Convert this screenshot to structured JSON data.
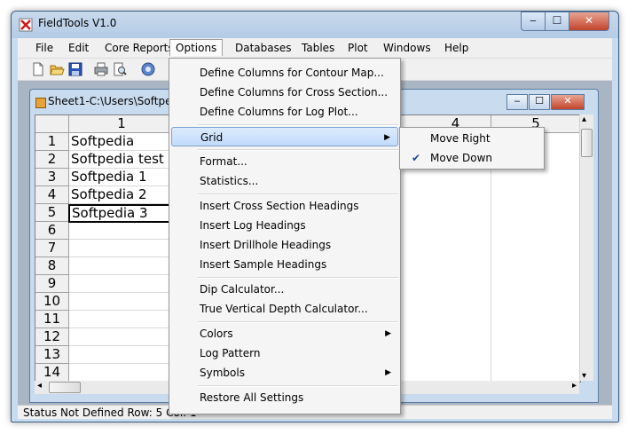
{
  "window": {
    "title": "FieldTools V1.0",
    "min": "‒",
    "max": "☐",
    "close": "✕"
  },
  "menubar": [
    "File",
    "Edit",
    "Core Reports",
    "Options",
    "Databases",
    "Tables",
    "Plot",
    "Windows",
    "Help"
  ],
  "toolbar": [
    "new-icon",
    "open-icon",
    "save-icon",
    "print-icon",
    "print-preview-icon",
    "settings-icon"
  ],
  "child": {
    "title": "Sheet1-C:\\Users\\Softpedia",
    "min": "‒",
    "max": "☐",
    "close": "✕"
  },
  "grid": {
    "col_headers": [
      "1",
      "4",
      "5"
    ],
    "rows": [
      "1",
      "2",
      "3",
      "4",
      "5",
      "6",
      "7",
      "8",
      "9",
      "10",
      "11",
      "12",
      "13",
      "14"
    ],
    "cells": [
      "Softpedia",
      "Softpedia test",
      "Softpedia 1",
      "Softpedia 2",
      "Softpedia 3"
    ],
    "scroll_left": "◂",
    "scroll_right": "▸",
    "scroll_up": "▴",
    "scroll_down": "▾"
  },
  "status": "Status  Not Defined  Row:  5   Col:  1",
  "options_menu": {
    "items": [
      "Define Columns for Contour Map...",
      "Define Columns for Cross Section...",
      "Define Columns for Log Plot...",
      "Grid",
      "Format...",
      "Statistics...",
      "Insert Cross Section Headings",
      "Insert Log Headings",
      "Insert Drillhole Headings",
      "Insert Sample Headings",
      "Dip Calculator...",
      "True Vertical Depth Calculator...",
      "Colors",
      "Log Pattern",
      "Symbols",
      "Restore All Settings"
    ],
    "arrow": "▶"
  },
  "grid_submenu": {
    "items": [
      "Move Right",
      "Move Down"
    ],
    "check": "✔"
  }
}
